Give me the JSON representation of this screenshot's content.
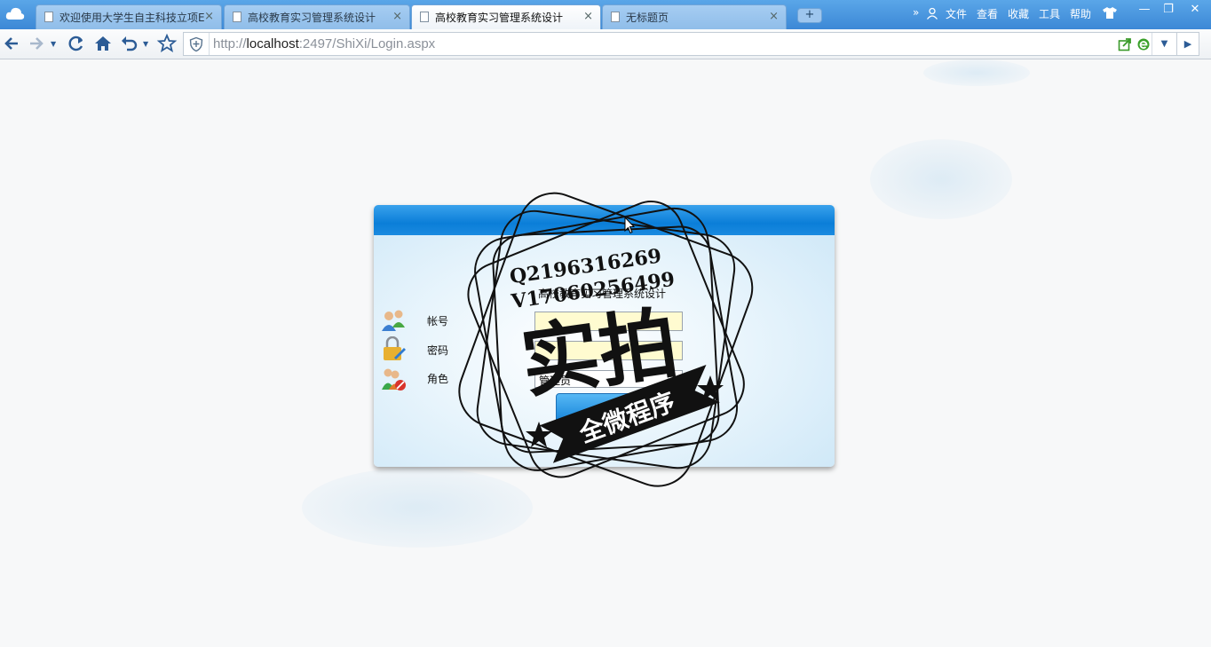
{
  "tabs": [
    {
      "title": "欢迎使用大学生自主科技立项E",
      "active": false
    },
    {
      "title": "高校教育实习管理系统设计",
      "active": false
    },
    {
      "title": "高校教育实习管理系统设计",
      "active": true
    },
    {
      "title": "无标题页",
      "active": false
    }
  ],
  "tab_close_glyph": "×",
  "new_tab_glyph": "+",
  "menu": {
    "more": "»",
    "items": [
      "文件",
      "查看",
      "收藏",
      "工具",
      "帮助"
    ]
  },
  "window_controls": {
    "minimize": "—",
    "restore": "❐",
    "close": "✕"
  },
  "nav": {
    "back_icon": "back-arrow-icon",
    "forward_icon": "forward-arrow-icon",
    "refresh_icon": "refresh-icon",
    "home_icon": "home-icon",
    "undo_icon": "undo-icon",
    "favorite_icon": "star-icon"
  },
  "address": {
    "scheme": "http://",
    "host": "localhost",
    "rest": ":2497/ShiXi/Login.aspx"
  },
  "login": {
    "title": "高校教育实习管理系统设计",
    "account_label": "帐号",
    "password_label": "密码",
    "role_label": "角色",
    "account_value": "",
    "password_value": "",
    "role_selected": "管理员"
  },
  "watermark": {
    "line1": "Q2196316269",
    "line2": "V17060256499",
    "big": "实拍",
    "banner": "全微程序"
  },
  "colors": {
    "tabbar": "#4a97df",
    "login_header": "#0b7ed8",
    "field_bg": "#fffbd0"
  }
}
